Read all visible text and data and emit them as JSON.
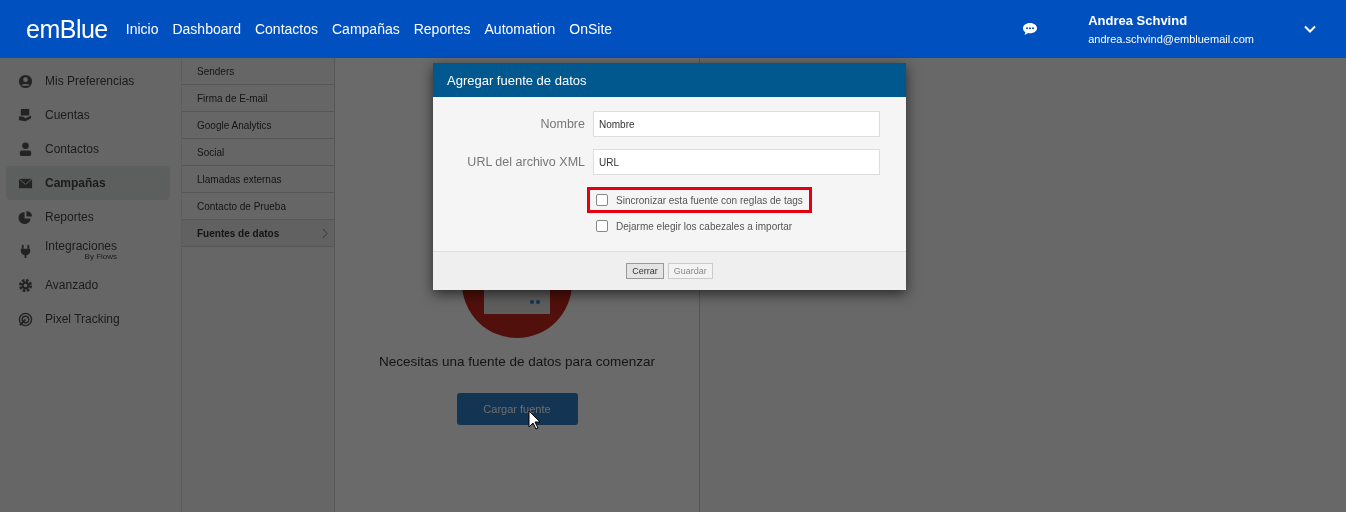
{
  "header": {
    "logo": "emBlue",
    "nav": [
      {
        "label": "Inicio"
      },
      {
        "label": "Dashboard"
      },
      {
        "label": "Contactos"
      },
      {
        "label": "Campañas"
      },
      {
        "label": "Reportes"
      },
      {
        "label": "Automation"
      },
      {
        "label": "OnSite"
      }
    ],
    "user": {
      "name": "Andrea Schvind",
      "email": "andrea.schvind@embluemail.com"
    }
  },
  "sidebar": {
    "items": [
      {
        "label": "Mis Preferencias",
        "selected": false
      },
      {
        "label": "Cuentas",
        "selected": false
      },
      {
        "label": "Contactos",
        "selected": false
      },
      {
        "label": "Campañas",
        "selected": true
      },
      {
        "label": "Reportes",
        "selected": false
      },
      {
        "label": "Integraciones",
        "sublabel": "By Flows",
        "selected": false
      },
      {
        "label": "Avanzado",
        "selected": false
      },
      {
        "label": "Pixel Tracking",
        "selected": false
      }
    ]
  },
  "submenu": {
    "items": [
      {
        "label": "Senders",
        "selected": false
      },
      {
        "label": "Firma de E-mail",
        "selected": false
      },
      {
        "label": "Google Analytics",
        "selected": false
      },
      {
        "label": "Social",
        "selected": false
      },
      {
        "label": "Llamadas externas",
        "selected": false
      },
      {
        "label": "Contacto de Prueba",
        "selected": false
      },
      {
        "label": "Fuentes de datos",
        "selected": true
      }
    ]
  },
  "content": {
    "message": "Necesitas una fuente de datos para comenzar",
    "button": "Cargar fuente"
  },
  "dialog": {
    "title": "Agregar fuente de datos",
    "fields": [
      {
        "label": "Nombre",
        "placeholder": "Nombre"
      },
      {
        "label": "URL del archivo XML",
        "placeholder": "URL"
      }
    ],
    "options": [
      {
        "label": "Sincronizar esta fuente con reglas de tags",
        "checked": false,
        "highlighted": true
      },
      {
        "label": "Dejarme elegir los cabezales a importar",
        "checked": false,
        "highlighted": false
      }
    ],
    "buttons": [
      {
        "label": "Cerrar",
        "disabled": false
      },
      {
        "label": "Guardar",
        "disabled": true
      }
    ]
  }
}
